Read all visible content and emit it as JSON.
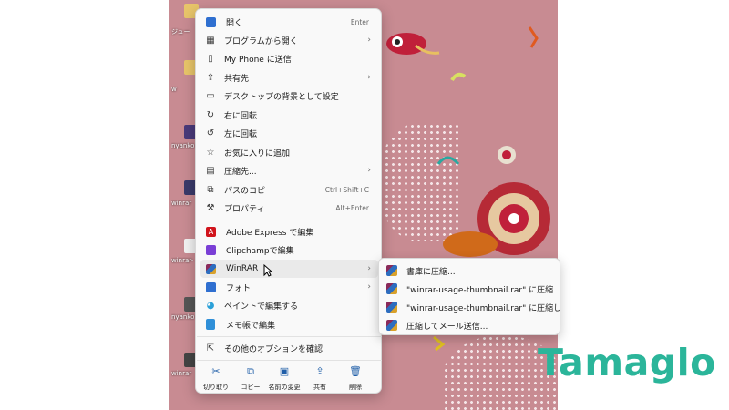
{
  "menu": {
    "items": [
      {
        "label": "開く",
        "shortcut": "Enter",
        "arrow": false,
        "icon": "photos-icon"
      },
      {
        "label": "プログラムから開く",
        "shortcut": "",
        "arrow": true,
        "icon": "open-with-icon"
      },
      {
        "label": "My Phone に送信",
        "shortcut": "",
        "arrow": false,
        "icon": "phone-icon"
      },
      {
        "label": "共有先",
        "shortcut": "",
        "arrow": true,
        "icon": "share-icon"
      },
      {
        "label": "デスクトップの背景として設定",
        "shortcut": "",
        "arrow": false,
        "icon": "wallpaper-icon"
      },
      {
        "label": "右に回転",
        "shortcut": "",
        "arrow": false,
        "icon": "rotate-right-icon"
      },
      {
        "label": "左に回転",
        "shortcut": "",
        "arrow": false,
        "icon": "rotate-left-icon"
      },
      {
        "label": "お気に入りに追加",
        "shortcut": "",
        "arrow": false,
        "icon": "star-icon"
      },
      {
        "label": "圧縮先...",
        "shortcut": "",
        "arrow": true,
        "icon": "zip-folder-icon"
      },
      {
        "label": "パスのコピー",
        "shortcut": "Ctrl+Shift+C",
        "arrow": false,
        "icon": "copy-path-icon"
      },
      {
        "label": "プロパティ",
        "shortcut": "Alt+Enter",
        "arrow": false,
        "icon": "wrench-icon"
      },
      {
        "label": "Adobe Express で編集",
        "shortcut": "",
        "arrow": false,
        "icon": "adobe-icon"
      },
      {
        "label": "Clipchampで編集",
        "shortcut": "",
        "arrow": false,
        "icon": "clipchamp-icon"
      },
      {
        "label": "WinRAR",
        "shortcut": "",
        "arrow": true,
        "icon": "winrar-icon"
      },
      {
        "label": "フォト",
        "shortcut": "",
        "arrow": true,
        "icon": "photos-icon"
      },
      {
        "label": "ペイントで編集する",
        "shortcut": "",
        "arrow": false,
        "icon": "paint-icon"
      },
      {
        "label": "メモ帳で編集",
        "shortcut": "",
        "arrow": false,
        "icon": "notepad-icon"
      },
      {
        "label": "その他のオプションを確認",
        "shortcut": "",
        "arrow": false,
        "icon": "more-options-icon"
      }
    ],
    "bottom": [
      {
        "label": "切り取り",
        "icon": "scissors-icon"
      },
      {
        "label": "コピー",
        "icon": "copy-icon"
      },
      {
        "label": "名前の変更",
        "icon": "rename-icon"
      },
      {
        "label": "共有",
        "icon": "share-icon"
      },
      {
        "label": "削除",
        "icon": "trash-icon"
      }
    ]
  },
  "submenu": {
    "items": [
      {
        "label": "書庫に圧縮..."
      },
      {
        "label": "\"winrar-usage-thumbnail.rar\" に圧縮"
      },
      {
        "label": "\"winrar-usage-thumbnail.rar\" に圧縮してメール"
      },
      {
        "label": "圧縮してメール送信..."
      }
    ]
  },
  "desktop": {
    "labels": [
      "ジュー",
      "w",
      "nyanko",
      "winrar",
      "winrar-",
      "nyanko",
      "winrar"
    ]
  },
  "logo": {
    "text": "Tamaglo"
  },
  "colors": {
    "accent": "#2bb59a",
    "desktop": "#c88b92",
    "icon_blue": "#1f5ea8"
  }
}
